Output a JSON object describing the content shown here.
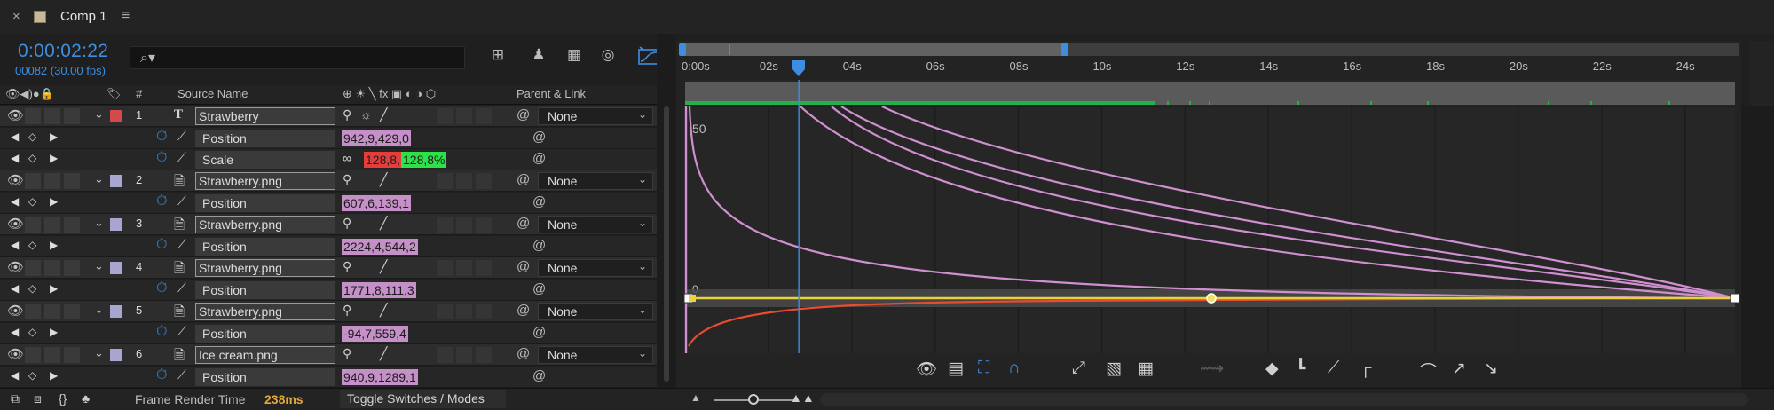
{
  "tab": {
    "close": "×",
    "title": "Comp 1",
    "menu": "≡",
    "swatch_color": "#c6b899"
  },
  "time": {
    "timecode": "0:00:02:22",
    "fps": "00082 (30.00 fps)"
  },
  "search": {
    "icon": "search-icon",
    "glyph": "⌕▾"
  },
  "toolbar_icons": [
    "tree-flow-icon",
    "shy-layers-icon",
    "frame-blending-icon",
    "motion-blur-icon",
    "graph-editor-icon"
  ],
  "header": {
    "source_name": "Source Name",
    "hash": "#",
    "parent_link": "Parent & Link",
    "switches": "⊕ ☀ ╲ fx ▣ ◐ ◑ ⬡"
  },
  "layers": [
    {
      "num": "1",
      "type": "T",
      "name": "Strawberry",
      "label_color": "#d44a4a",
      "parent": "None",
      "props": [
        {
          "name": "Position",
          "values": [
            "942,9,429,0"
          ]
        },
        {
          "name": "Scale",
          "values": [
            "128,8,",
            "128,8%"
          ],
          "linked": true
        }
      ]
    },
    {
      "num": "2",
      "type": "file",
      "name": "Strawberry.png",
      "label_color": "#a8a6d1",
      "parent": "None",
      "props": [
        {
          "name": "Position",
          "values": [
            "607,6,139,1"
          ]
        }
      ]
    },
    {
      "num": "3",
      "type": "file",
      "name": "Strawberry.png",
      "label_color": "#a8a6d1",
      "parent": "None",
      "props": [
        {
          "name": "Position",
          "values": [
            "2224,4,544,2"
          ]
        }
      ]
    },
    {
      "num": "4",
      "type": "file",
      "name": "Strawberry.png",
      "label_color": "#a8a6d1",
      "parent": "None",
      "props": [
        {
          "name": "Position",
          "values": [
            "1771,8,111,3"
          ]
        }
      ]
    },
    {
      "num": "5",
      "type": "file",
      "name": "Strawberry.png",
      "label_color": "#a8a6d1",
      "parent": "None",
      "props": [
        {
          "name": "Position",
          "values": [
            "-94,7,559,4"
          ]
        }
      ]
    },
    {
      "num": "6",
      "type": "file",
      "name": "Ice cream.png",
      "label_color": "#a8a6d1",
      "parent": "None",
      "props": [
        {
          "name": "Position",
          "values": [
            "940,9,1289,1"
          ]
        }
      ]
    }
  ],
  "ruler": {
    "ticks": [
      "0:00s",
      "02s",
      "04s",
      "06s",
      "08s",
      "10s",
      "12s",
      "14s",
      "16s",
      "18s",
      "20s",
      "22s",
      "24s"
    ],
    "current_time_seconds": 2.73,
    "work_area_end_seconds": 9.0,
    "duration_seconds": 25.2
  },
  "graph": {
    "y_label_top": "50",
    "y_label_zero": "0",
    "curve_color": "#d08fd0",
    "value_curve_color": "#e84b2e",
    "speed_line_color": "#e8d23a"
  },
  "footer": {
    "frame_render_label": "Frame Render Time",
    "frame_render_value": "238ms",
    "toggle_label": "Toggle Switches / Modes"
  },
  "graph_tools": [
    "eye-icon",
    "graph-type-icon",
    "show-transform-box-icon",
    "snap-icon",
    "fit-selection-icon",
    "fit-all-icon",
    "separate-dimensions-icon",
    "edit-selected-keyframes-icon",
    "convert-hold-icon",
    "convert-auto-bezier-icon",
    "easy-ease-icon",
    "easy-ease-in-icon",
    "easy-ease-out-icon"
  ]
}
